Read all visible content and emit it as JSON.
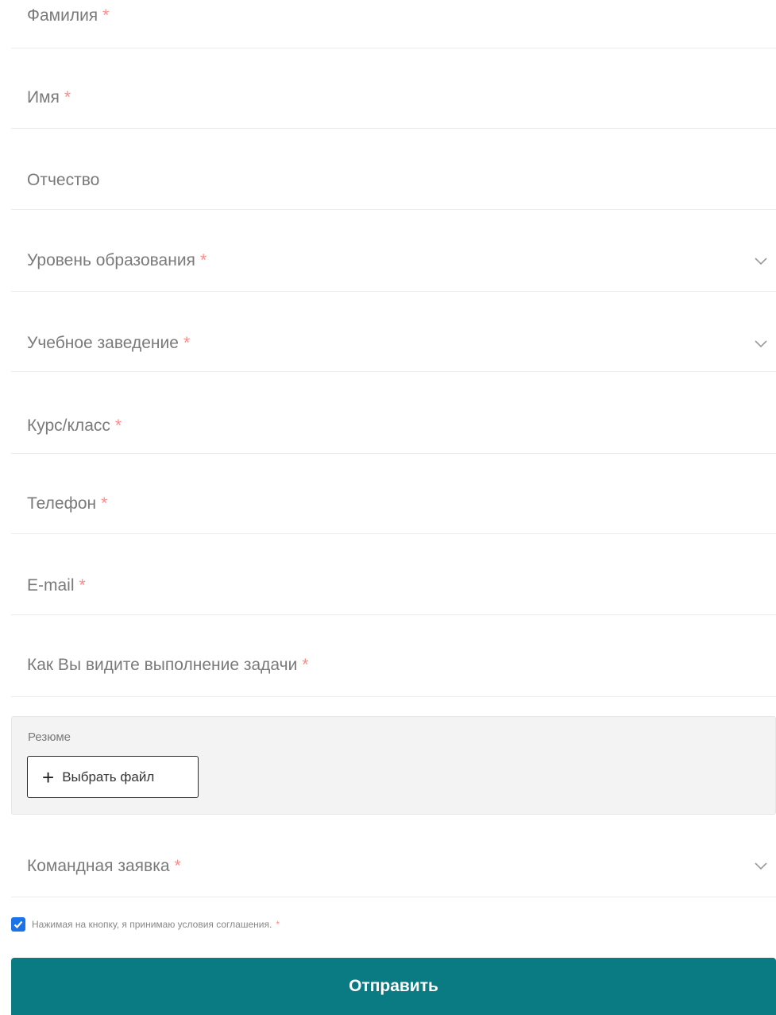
{
  "form": {
    "fields": [
      {
        "label": "Фамилия",
        "required": "*"
      },
      {
        "label": "Имя",
        "required": "*"
      },
      {
        "label": "Отчество"
      },
      {
        "label": "Уровень образования",
        "required": "*",
        "icon": "chevron-down-icon"
      },
      {
        "label": "Учебное заведение",
        "required": "*",
        "icon": "chevron-down-icon"
      },
      {
        "label": "Курс/класс",
        "required": "*"
      },
      {
        "label": "Телефон",
        "required": "*"
      },
      {
        "label": "E-mail",
        "required": "*"
      },
      {
        "label": "Как Вы видите выполнение задачи",
        "required": "*"
      }
    ],
    "resume": {
      "label": "Резюме",
      "button_label": "Выбрать файл",
      "button_icon": "plus-icon"
    },
    "team_request": {
      "label": "Командная заявка",
      "required": "*",
      "icon": "chevron-down-icon"
    },
    "consent": {
      "text": "Нажимая на кнопку, я принимаю условия соглашения.",
      "required": "*",
      "checked": true
    },
    "submit_label": "Отправить"
  },
  "colors": {
    "accent": "#0a7a83",
    "required": "#ff8a8a",
    "checkbox": "#1a73e8",
    "label": "#7a7a7a",
    "file_box_bg": "#f3f3f3"
  }
}
